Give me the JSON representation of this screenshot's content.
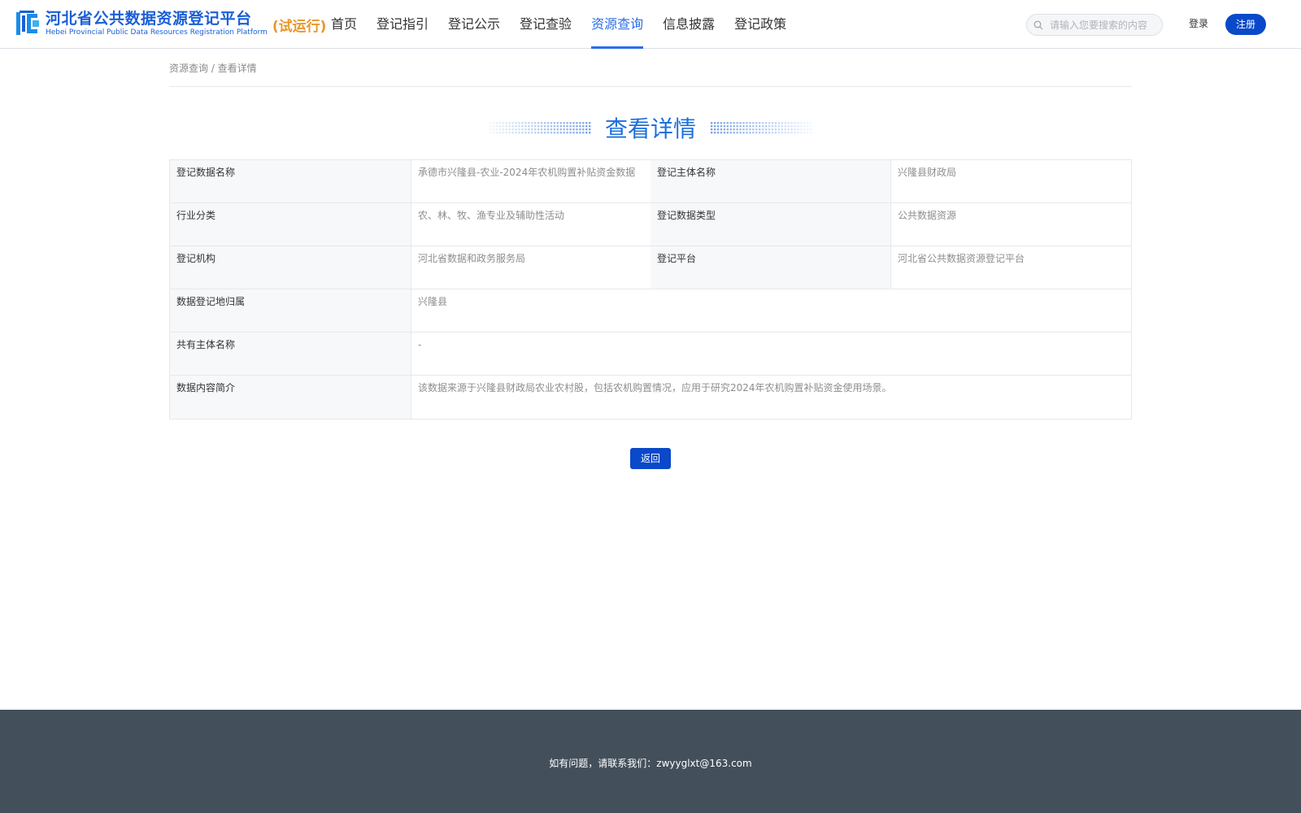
{
  "header": {
    "logo_cn": "河北省公共数据资源登记平台",
    "logo_en": "Hebei Provincial Public Data Resources Registration Platform",
    "logo_trial": "(试运行)",
    "nav": [
      {
        "label": "首页"
      },
      {
        "label": "登记指引"
      },
      {
        "label": "登记公示"
      },
      {
        "label": "登记查验"
      },
      {
        "label": "资源查询"
      },
      {
        "label": "信息披露"
      },
      {
        "label": "登记政策"
      }
    ],
    "active_nav": "资源查询",
    "search_placeholder": "请输入您要搜索的内容",
    "login_label": "登录",
    "register_label": "注册"
  },
  "breadcrumb": "资源查询 / 查看详情",
  "page_title": "查看详情",
  "detail": {
    "rows": [
      {
        "l1": "登记数据名称",
        "v1": "承德市兴隆县-农业-2024年农机购置补贴资金数据",
        "l2": "登记主体名称",
        "v2": "兴隆县财政局"
      },
      {
        "l1": "行业分类",
        "v1": "农、林、牧、渔专业及辅助性活动",
        "l2": "登记数据类型",
        "v2": "公共数据资源"
      },
      {
        "l1": "登记机构",
        "v1": "河北省数据和政务服务局",
        "l2": "登记平台",
        "v2": "河北省公共数据资源登记平台"
      },
      {
        "l1": "数据登记地归属",
        "v1": "兴隆县"
      },
      {
        "l1": "共有主体名称",
        "v1": "-"
      },
      {
        "l1": "数据内容简介",
        "v1": "该数据来源于兴隆县财政局农业农村股，包括农机购置情况，应用于研究2024年农机购置补贴资金使用场景。"
      }
    ]
  },
  "back_label": "返回",
  "footer": "如有问题，请联系我们：zwyyglxt@163.com",
  "colors": {
    "accent": "#0a49c9",
    "title": "#1e6fd9",
    "trial": "#e8972b",
    "footer_bg": "#434f5b"
  }
}
